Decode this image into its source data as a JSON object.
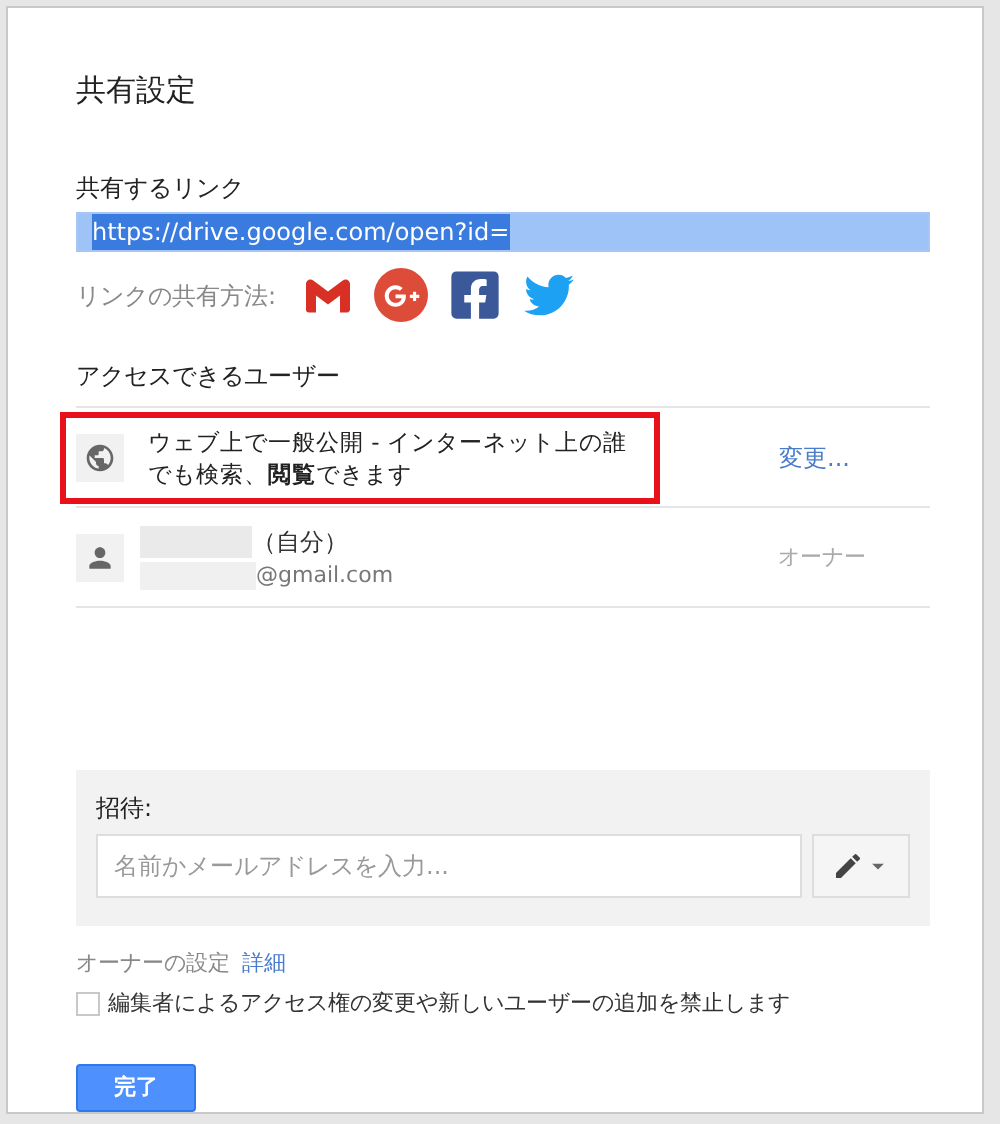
{
  "dialog": {
    "title": "共有設定"
  },
  "link": {
    "label": "共有するリンク",
    "value": "https://drive.google.com/open?id=",
    "selected": true
  },
  "share": {
    "label": "リンクの共有方法:",
    "services": [
      {
        "kind": "gmail"
      },
      {
        "kind": "googleplus"
      },
      {
        "kind": "facebook"
      },
      {
        "kind": "twitter"
      }
    ]
  },
  "access": {
    "label": "アクセスできるユーザー",
    "entries": [
      {
        "kind": "public",
        "text": "ウェブ上で一般公開 - インターネット上の誰でも検索、**閲覧**できます",
        "action": "変更...",
        "highlighted": true
      },
      {
        "kind": "person",
        "name_suffix": "（自分）",
        "email": "@gmail.com",
        "role": "オーナー",
        "highlighted": false
      }
    ]
  },
  "invite": {
    "label": "招待:",
    "placeholder": "名前かメールアドレスを入力..."
  },
  "owner_settings": {
    "label": "オーナーの設定",
    "link": "詳細",
    "option": {
      "label": "編集者によるアクセス権の変更や新しいユーザーの追加を禁止します",
      "checked": false
    }
  },
  "done_button": "完了"
}
